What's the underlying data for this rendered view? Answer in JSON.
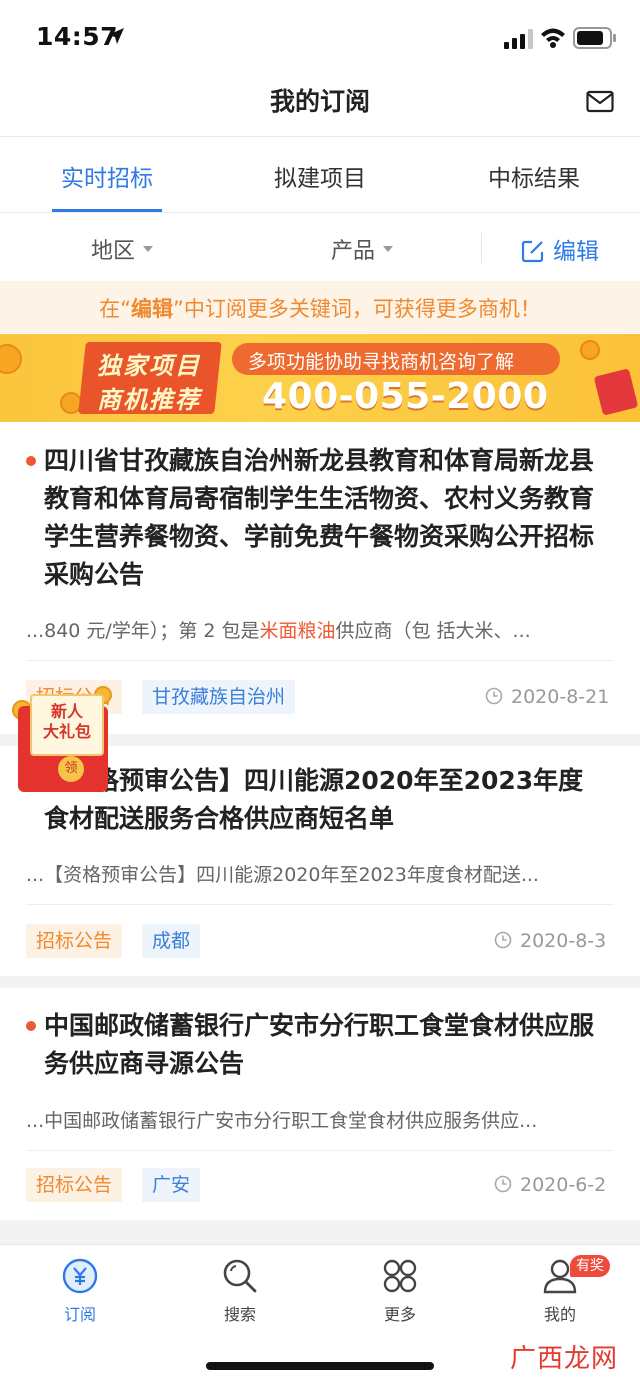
{
  "status_bar": {
    "time": "14:57"
  },
  "header": {
    "title": "我的订阅"
  },
  "tabs": [
    {
      "label": "实时招标",
      "active": true
    },
    {
      "label": "拟建项目",
      "active": false
    },
    {
      "label": "中标结果",
      "active": false
    }
  ],
  "filters": {
    "region": "地区",
    "product": "产品",
    "edit": "编辑"
  },
  "tip": {
    "prefix": "在“",
    "keyword": "编辑",
    "suffix": "”中订阅更多关键词，可获得更多商机！"
  },
  "promo": {
    "badge_line1": "独家项目",
    "badge_line2": "商机推荐",
    "subtitle": "多项功能协助寻找商机咨询了解",
    "phone": "400-055-2000"
  },
  "gift": {
    "line1": "新人",
    "line2": "大礼包",
    "seal": "领"
  },
  "cards": [
    {
      "title": "四川省甘孜藏族自治州新龙县教育和体育局新龙县教育和体育局寄宿制学生生活物资、农村义务教育学生营养餐物资、学前免费午餐物资采购公开招标采购公告",
      "snippet_before": "...840 元/学年）；第 2 包是",
      "snippet_highlight": "米面粮油",
      "snippet_after": "供应商（包 括大米、...",
      "tag_type": "招标公告",
      "tag_region": "甘孜藏族自治州",
      "date": "2020-8-21"
    },
    {
      "title": "【资格预审公告】四川能源2020年至2023年度食材配送服务合格供应商短名单",
      "snippet": "...【资格预审公告】四川能源2020年至2023年度食材配送...",
      "tag_type": "招标公告",
      "tag_region": "成都",
      "date": "2020-8-3"
    },
    {
      "title": "中国邮政储蓄银行广安市分行职工食堂食材供应服务供应商寻源公告",
      "snippet": "...中国邮政储蓄银行广安市分行职工食堂食材供应服务供应...",
      "tag_type": "招标公告",
      "tag_region": "广安",
      "date": "2020-6-2"
    }
  ],
  "tabbar": [
    {
      "label": "订阅",
      "icon": "subscribe-icon",
      "active": true
    },
    {
      "label": "搜索",
      "icon": "search-icon",
      "active": false
    },
    {
      "label": "更多",
      "icon": "more-grid-icon",
      "active": false
    },
    {
      "label": "我的",
      "icon": "profile-icon",
      "active": false,
      "badge": "有奖"
    }
  ],
  "watermark": "广西龙网",
  "colors": {
    "accent": "#2f7ae5",
    "orange": "#ef8a30",
    "red_dot": "#ec5a32"
  }
}
